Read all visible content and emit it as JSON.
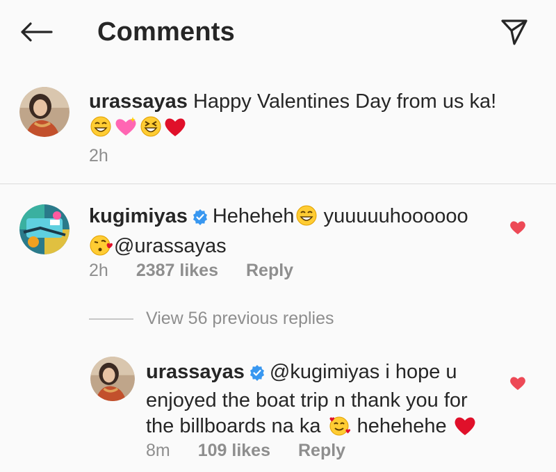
{
  "header": {
    "title": "Comments",
    "back_icon": "arrow-left-icon",
    "send_icon": "paper-plane-icon"
  },
  "caption": {
    "username": "urassayas",
    "text": " Happy Valentines Day from us ka!",
    "emojis": [
      "grinning-squint-emoji",
      "sparkling-heart-emoji",
      "laughing-emoji",
      "red-heart-emoji"
    ],
    "time": "2h"
  },
  "comment": {
    "username": "kugimiyas",
    "verified": true,
    "text_part1": "Heheheh",
    "text_part2": " yuuuuuhoooooo",
    "mention": "@urassayas",
    "time": "2h",
    "likes": "2387 likes",
    "reply_label": "Reply",
    "liked": true
  },
  "view_replies": {
    "label": "View 56 previous replies"
  },
  "reply": {
    "username": "urassayas",
    "verified": true,
    "mention": "@kugimiyas",
    "line1": " i hope u",
    "line2": "enjoyed the boat trip n thank you for",
    "line3_a": "the billboards na ka ",
    "line3_b": " hehehehe ",
    "time": "8m",
    "likes": "109 likes",
    "reply_label": "Reply",
    "liked": true
  },
  "colors": {
    "text": "#262626",
    "secondary": "#8e8e8e",
    "heart": "#ed4956",
    "verified": "#3897f0",
    "background": "#fafafa"
  }
}
